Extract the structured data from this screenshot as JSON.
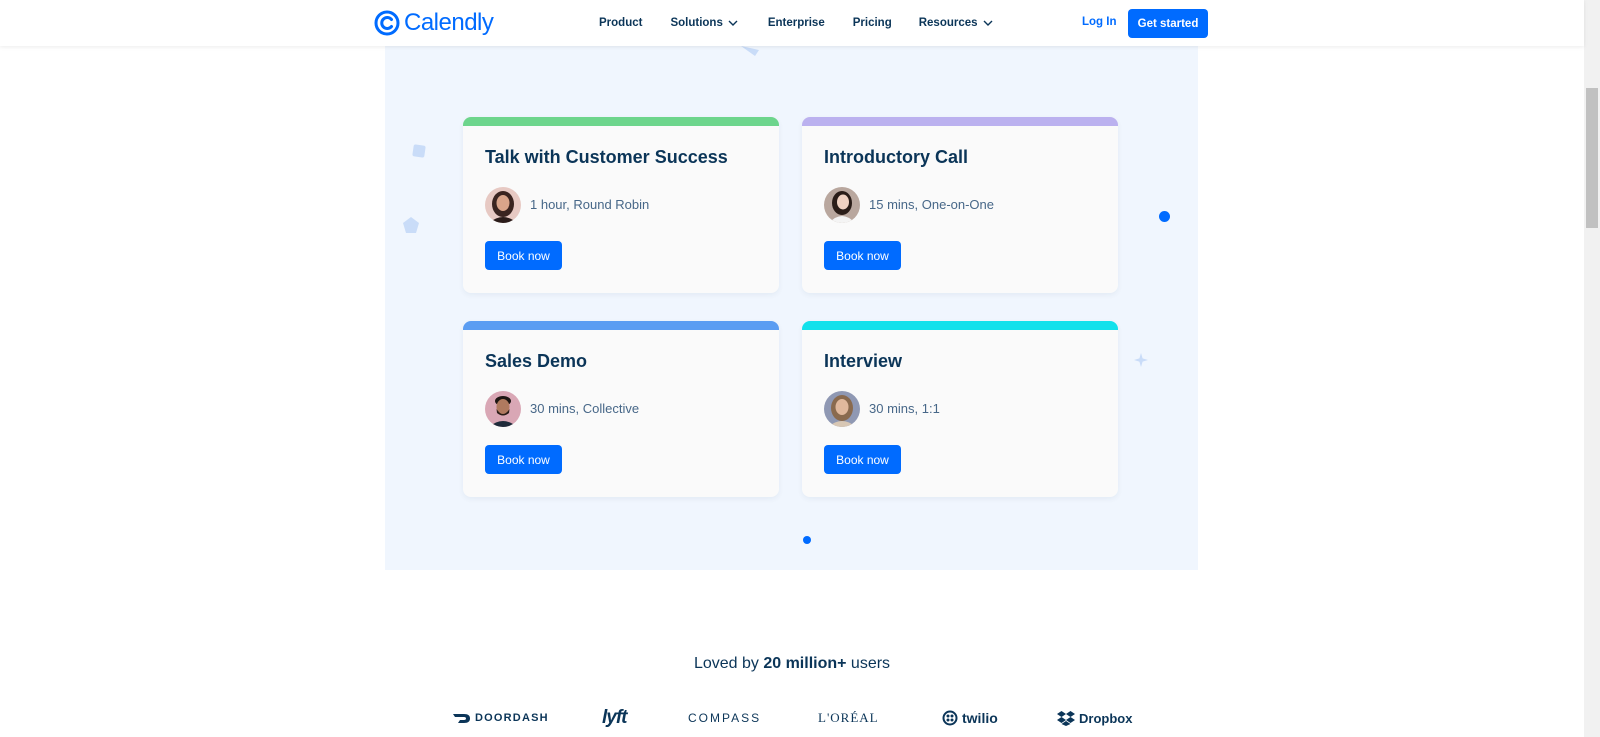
{
  "header": {
    "logo_text": "Calendly",
    "nav": [
      {
        "label": "Product",
        "has_dropdown": false
      },
      {
        "label": "Solutions",
        "has_dropdown": true
      },
      {
        "label": "Enterprise",
        "has_dropdown": false
      },
      {
        "label": "Pricing",
        "has_dropdown": false
      },
      {
        "label": "Resources",
        "has_dropdown": true
      }
    ],
    "login_label": "Log In",
    "cta_label": "Get started"
  },
  "cards": [
    {
      "title": "Talk with Customer Success",
      "meta": "1 hour, Round Robin",
      "button": "Book now",
      "accent": "#6dd58c"
    },
    {
      "title": "Introductory Call",
      "meta": "15 mins, One-on-One",
      "button": "Book now",
      "accent": "#bbb1ef"
    },
    {
      "title": "Sales Demo",
      "meta": "30 mins, Collective",
      "button": "Book now",
      "accent": "#5b9df2"
    },
    {
      "title": "Interview",
      "meta": "30 mins, 1:1",
      "button": "Book now",
      "accent": "#13e1eb"
    }
  ],
  "social_proof": {
    "prefix": "Loved by ",
    "highlight": "20 million+",
    "suffix": " users"
  },
  "brands": [
    "DOORDASH",
    "lyft",
    "COMPASS",
    "L'ORÉAL",
    "twilio",
    "Dropbox"
  ],
  "colors": {
    "primary": "#006bff",
    "text": "#0b3558",
    "panel_bg": "#f0f6fe"
  }
}
